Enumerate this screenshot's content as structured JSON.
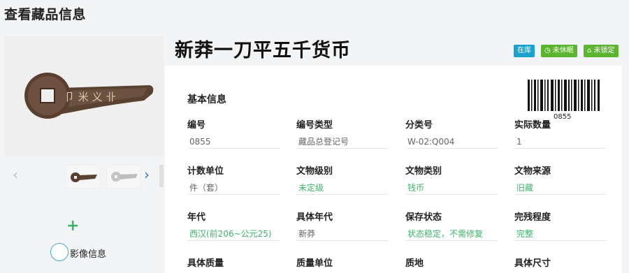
{
  "page": {
    "title": "查看藏品信息"
  },
  "gallery": {
    "prev_icon": "‹",
    "next_icon": "›",
    "add_icon": "+",
    "timeline_label": "影像信息"
  },
  "item": {
    "title": "新莽一刀平五千货币",
    "tags": {
      "in_stock": "在库",
      "not_dormant": "未休眠",
      "not_locked": "未锁定"
    },
    "barcode_number": "0855"
  },
  "basic_info": {
    "section_title": "基本信息",
    "rows": [
      [
        {
          "label": "编号",
          "value": "0855",
          "color": "gray"
        },
        {
          "label": "编号类型",
          "value": "藏品总登记号",
          "color": "gray"
        },
        {
          "label": "分类号",
          "value": "W-02:Q004",
          "color": "gray"
        },
        {
          "label": "实际数量",
          "value": "1",
          "color": "gray"
        }
      ],
      [
        {
          "label": "计数单位",
          "value": "件（套）",
          "color": "gray"
        },
        {
          "label": "文物级别",
          "value": "未定级",
          "color": "green"
        },
        {
          "label": "文物类别",
          "value": "钱币",
          "color": "green"
        },
        {
          "label": "文物来源",
          "value": "旧藏",
          "color": "green"
        }
      ],
      [
        {
          "label": "年代",
          "value": "西汉(前206~公元25)",
          "color": "green"
        },
        {
          "label": "具体年代",
          "value": "新莽",
          "color": "gray"
        },
        {
          "label": "保存状态",
          "value": "状态稳定，不需修复",
          "color": "green"
        },
        {
          "label": "完残程度",
          "value": "完整",
          "color": "green"
        }
      ],
      [
        {
          "label": "具体质量",
          "value": "",
          "color": "gray"
        },
        {
          "label": "质量单位",
          "value": "",
          "color": "gray"
        },
        {
          "label": "质地",
          "value": "",
          "color": "gray"
        },
        {
          "label": "具体尺寸",
          "value": "",
          "color": "gray"
        }
      ]
    ]
  }
}
